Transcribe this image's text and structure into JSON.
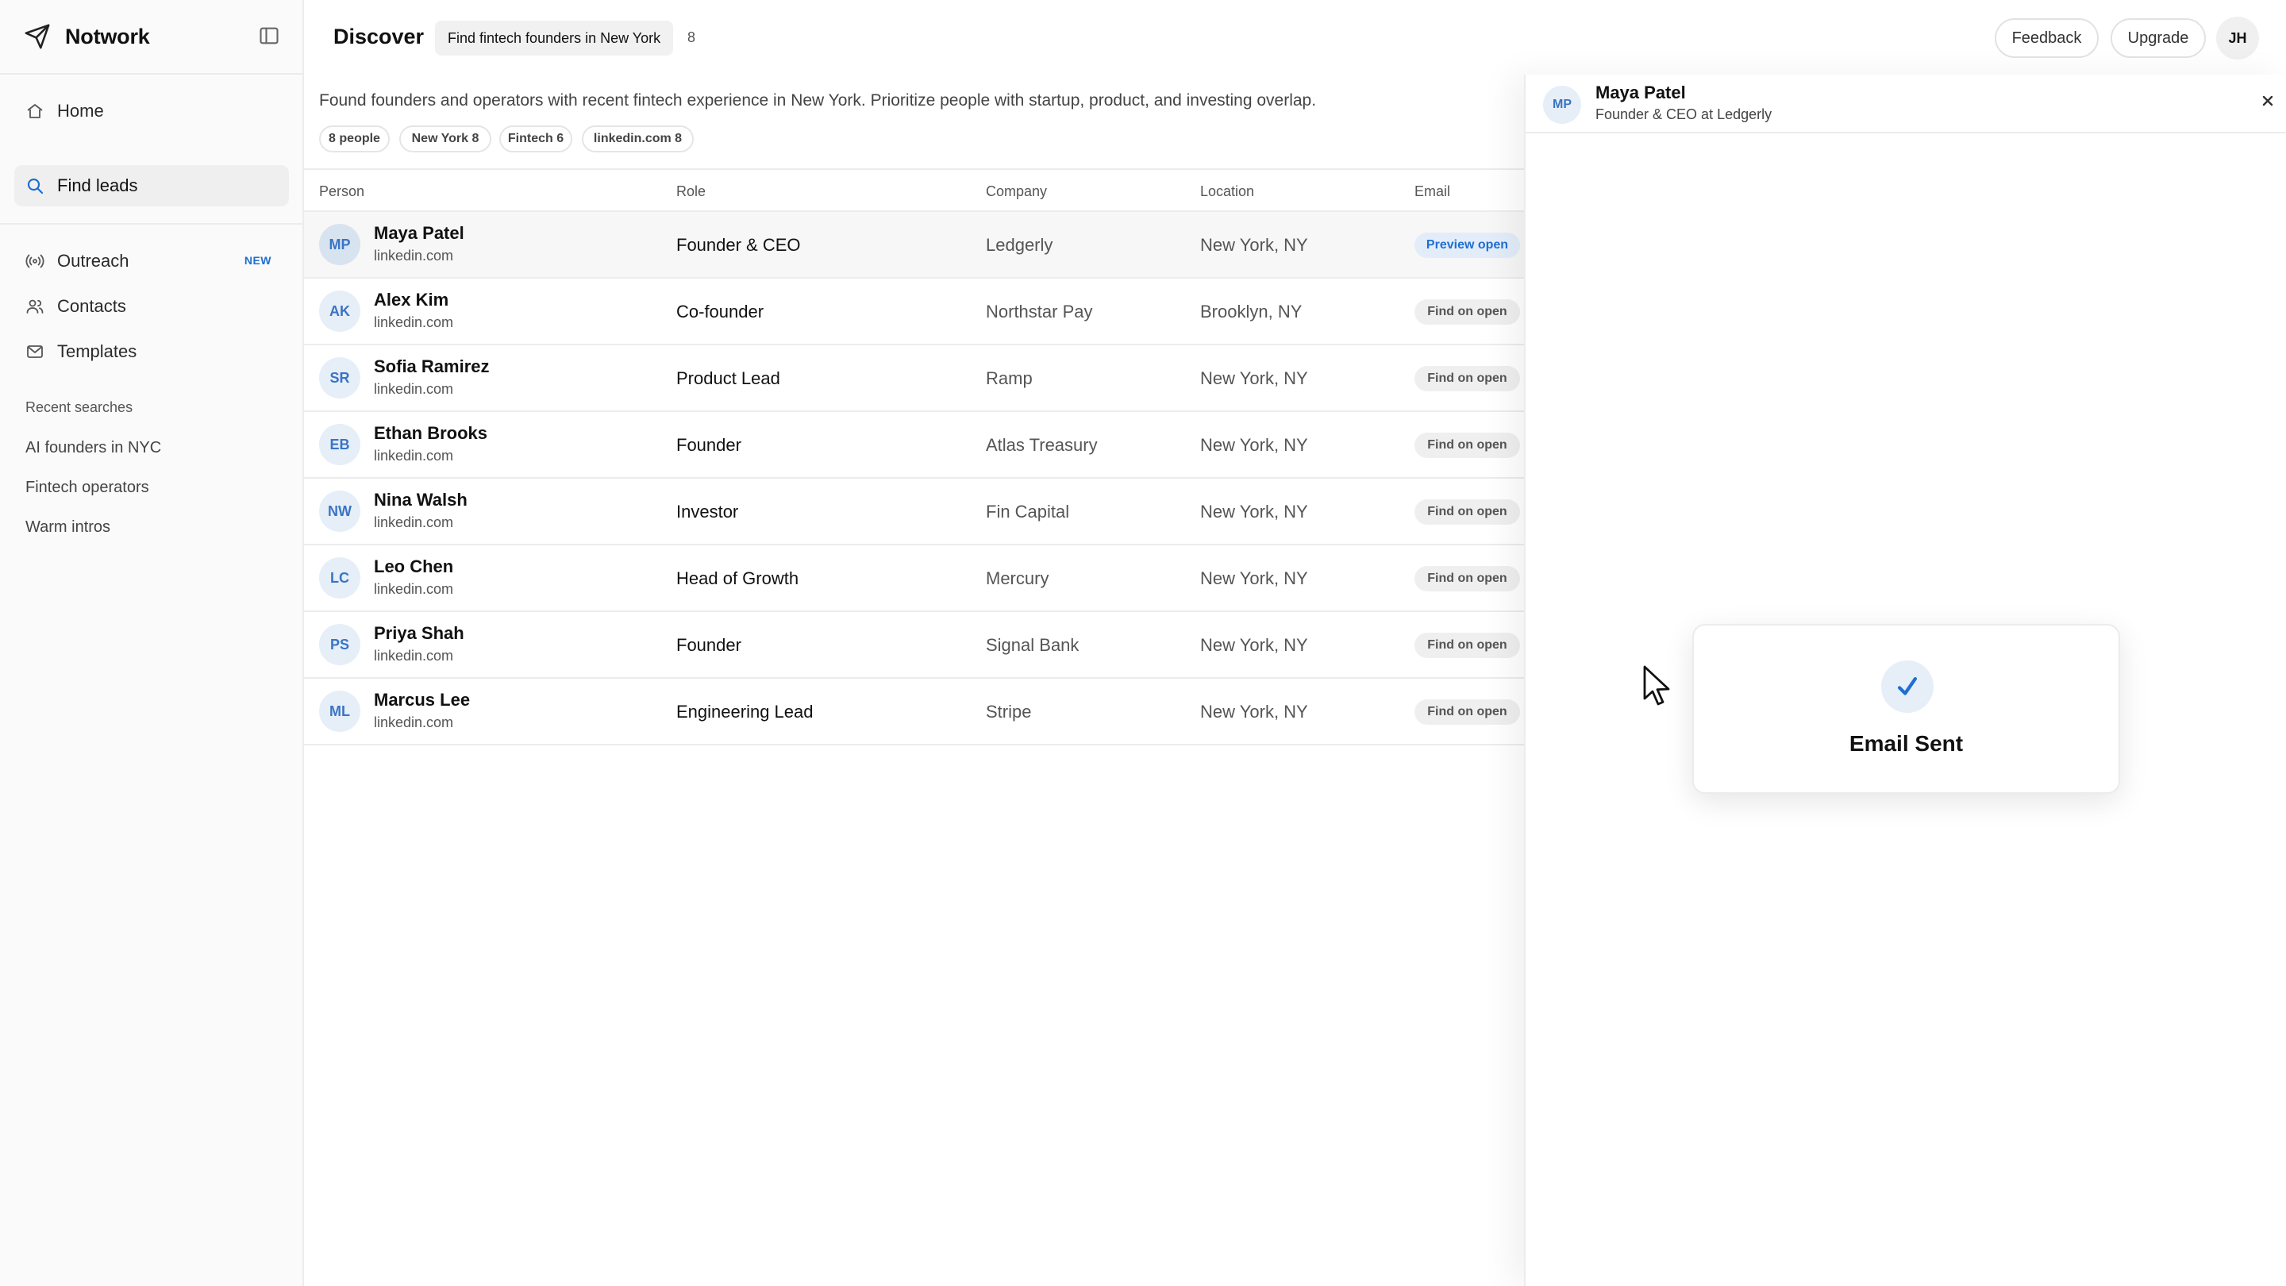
{
  "app": {
    "name": "Notwork",
    "icon": "paper-plane-icon"
  },
  "sidebar": {
    "nav": [
      {
        "label": "Home",
        "icon": "home-icon"
      },
      {
        "label": "Find leads",
        "icon": "search-icon",
        "active": true
      }
    ],
    "nav2": [
      {
        "label": "Outreach",
        "icon": "broadcast-icon",
        "badge": "NEW"
      },
      {
        "label": "Contacts",
        "icon": "users-icon"
      },
      {
        "label": "Templates",
        "icon": "mail-icon"
      }
    ],
    "recent_heading": "Recent searches",
    "recent": [
      "AI founders in NYC",
      "Fintech operators",
      "Warm intros"
    ]
  },
  "header": {
    "title": "Discover",
    "query": "Find fintech founders in New York",
    "query_count": "8",
    "feedback": "Feedback",
    "upgrade": "Upgrade",
    "user_initials": "JH"
  },
  "summary": {
    "text": "Found founders and operators with recent fintech experience in New York. Prioritize people with startup, product, and investing overlap.",
    "chips": [
      "8 people",
      "New York 8",
      "Fintech 6",
      "linkedin.com 8"
    ]
  },
  "table": {
    "columns": [
      "Person",
      "Role",
      "Company",
      "Location",
      "Email"
    ],
    "rows": [
      {
        "initials": "MP",
        "name": "Maya Patel",
        "source": "linkedin.com",
        "role": "Founder & CEO",
        "company": "Ledgerly",
        "location": "New York, NY",
        "email": "Preview open"
      },
      {
        "initials": "AK",
        "name": "Alex Kim",
        "source": "linkedin.com",
        "role": "Co-founder",
        "company": "Northstar Pay",
        "location": "Brooklyn, NY",
        "email": "Find on open"
      },
      {
        "initials": "SR",
        "name": "Sofia Ramirez",
        "source": "linkedin.com",
        "role": "Product Lead",
        "company": "Ramp",
        "location": "New York, NY",
        "email": "Find on open"
      },
      {
        "initials": "EB",
        "name": "Ethan Brooks",
        "source": "linkedin.com",
        "role": "Founder",
        "company": "Atlas Treasury",
        "location": "New York, NY",
        "email": "Find on open"
      },
      {
        "initials": "NW",
        "name": "Nina Walsh",
        "source": "linkedin.com",
        "role": "Investor",
        "company": "Fin Capital",
        "location": "New York, NY",
        "email": "Find on open"
      },
      {
        "initials": "LC",
        "name": "Leo Chen",
        "source": "linkedin.com",
        "role": "Head of Growth",
        "company": "Mercury",
        "location": "New York, NY",
        "email": "Find on open"
      },
      {
        "initials": "PS",
        "name": "Priya Shah",
        "source": "linkedin.com",
        "role": "Founder",
        "company": "Signal Bank",
        "location": "New York, NY",
        "email": "Find on open"
      },
      {
        "initials": "ML",
        "name": "Marcus Lee",
        "source": "linkedin.com",
        "role": "Engineering Lead",
        "company": "Stripe",
        "location": "New York, NY",
        "email": "Find on open"
      }
    ]
  },
  "panel": {
    "initials": "MP",
    "name": "Maya Patel",
    "subtitle": "Founder & CEO at Ledgerly",
    "toast": "Email Sent"
  },
  "colors": {
    "accent": "#1f6fd1",
    "avatar_bg": "#e6eef8",
    "sidebar_bg": "#fafafa"
  }
}
